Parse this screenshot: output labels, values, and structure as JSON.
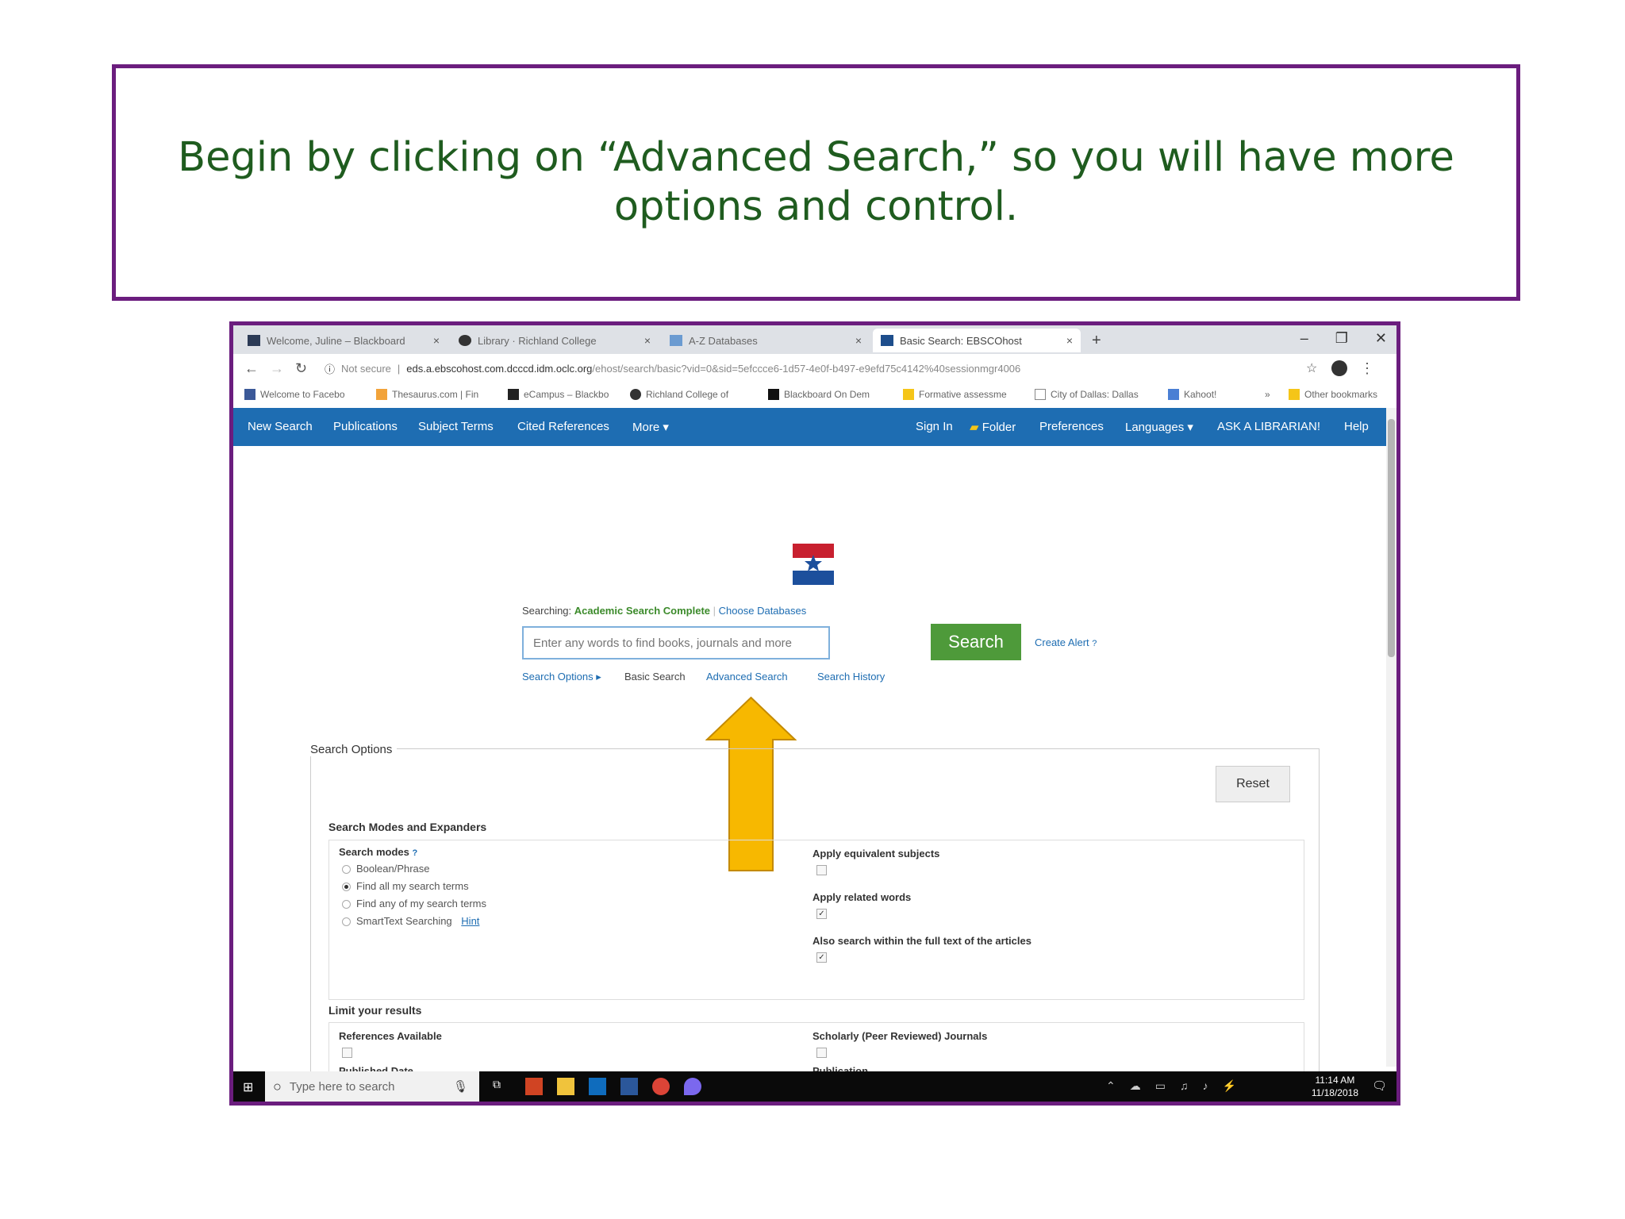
{
  "caption": "Begin by clicking on “Advanced Search,” so you will have more options and control.",
  "browser": {
    "tabs": [
      {
        "label": "Welcome, Juline – Blackboard"
      },
      {
        "label": "Library · Richland College"
      },
      {
        "label": "A-Z Databases"
      },
      {
        "label": "Basic Search: EBSCOhost"
      }
    ],
    "new_tab": "+",
    "close": "×",
    "security": "Not secure",
    "url_host": "eds.a.ebscohost.com.dcccd.idm.oclc.org",
    "url_path": "/ehost/search/basic?vid=0&sid=5efccce6-1d57-4e0f-b497-e9efd75c4142%40sessionmgr4006",
    "bookmarks": [
      "Welcome to Facebo",
      "Thesaurus.com | Fin",
      "eCampus – Blackbo",
      "Richland College of",
      "Blackboard On Dem",
      "Formative assessme",
      "City of Dallas: Dallas",
      "Kahoot!",
      "»",
      "Other bookmarks"
    ]
  },
  "topnav": {
    "left": [
      "New Search",
      "Publications",
      "Subject Terms",
      "Cited References",
      "More ▾"
    ],
    "right": [
      "Sign In",
      "Folder",
      "Preferences",
      "Languages ▾",
      "ASK A LIBRARIAN!",
      "Help"
    ]
  },
  "search": {
    "searching_prefix": "Searching:",
    "database": "Academic Search Complete",
    "choose_databases": "Choose Databases",
    "placeholder": "Enter any words to find books, journals and more",
    "button": "Search",
    "create_alert": "Create Alert",
    "links": [
      "Search Options ▸",
      "Basic Search",
      "Advanced Search",
      "Search History"
    ]
  },
  "options": {
    "title": "Search Options",
    "reset": "Reset",
    "modes_title": "Search Modes and Expanders",
    "modes_label": "Search modes",
    "modes": [
      "Boolean/Phrase",
      "Find all my search terms",
      "Find any of my search terms",
      "SmartText Searching"
    ],
    "hint": "Hint",
    "selected_mode": 1,
    "expanders": [
      "Apply equivalent subjects",
      "Apply related words",
      "Also search within the full text of the articles"
    ],
    "expanders_checked": [
      false,
      true,
      true
    ],
    "limit_title": "Limit your results",
    "limits": [
      "References Available",
      "Scholarly (Peer Reviewed) Journals"
    ],
    "limits_more": [
      "Published Date",
      "Publication"
    ]
  },
  "taskbar": {
    "search_placeholder": "Type here to search",
    "time": "11:14 AM",
    "date": "11/18/2018"
  },
  "colors": {
    "accent": "#1e6db2",
    "search_green": "#4e9a3a",
    "caption_green": "#1f5c1f",
    "frame_purple": "#6b1d7e",
    "arrow": "#f7b800"
  }
}
